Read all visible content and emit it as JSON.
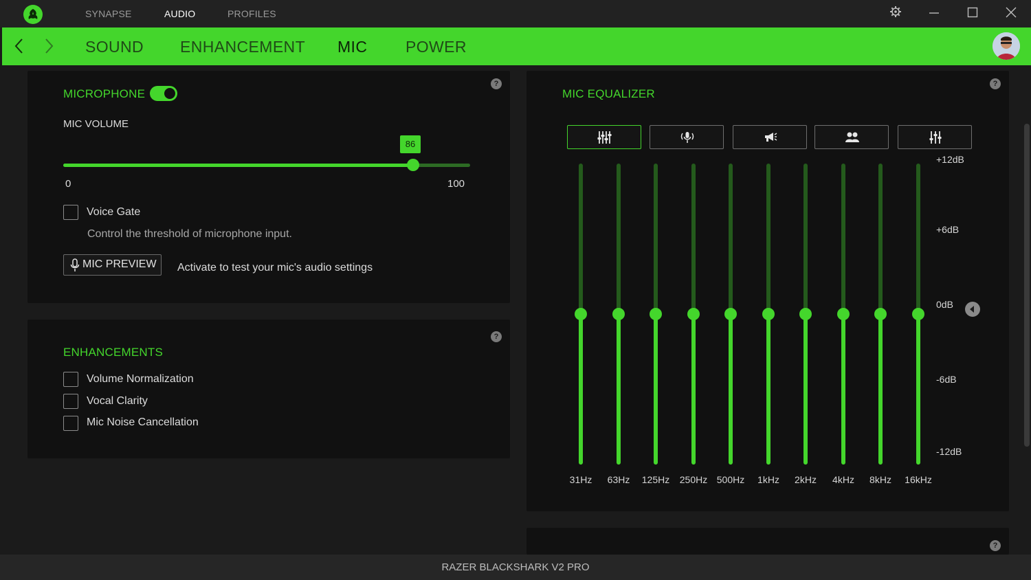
{
  "app": {
    "top_nav": [
      "SYNAPSE",
      "AUDIO",
      "PROFILES"
    ],
    "active_top_nav": "AUDIO"
  },
  "tabs": [
    "SOUND",
    "ENHANCEMENT",
    "MIC",
    "POWER"
  ],
  "active_tab": "MIC",
  "microphone": {
    "title": "MICROPHONE",
    "enabled": true,
    "volume_label": "MIC VOLUME",
    "volume_value": "86",
    "volume_min": "0",
    "volume_max": "100",
    "voice_gate_label": "Voice Gate",
    "voice_gate_desc": "Control the threshold of microphone input.",
    "voice_gate_checked": false,
    "preview_button": "MIC PREVIEW",
    "preview_desc": "Activate to test your mic's audio settings"
  },
  "enhancements": {
    "title": "ENHANCEMENTS",
    "options": [
      {
        "label": "Volume Normalization",
        "checked": false
      },
      {
        "label": "Vocal Clarity",
        "checked": false
      },
      {
        "label": "Mic Noise Cancellation",
        "checked": false
      }
    ]
  },
  "mic_equalizer": {
    "title": "MIC EQUALIZER",
    "presets": [
      "sliders-icon",
      "mic-broadcast-icon",
      "megaphone-icon",
      "people-icon",
      "custom-sliders-icon"
    ],
    "active_preset": 0,
    "db_labels": [
      "+12dB",
      "+6dB",
      "0dB",
      "-6dB",
      "-12dB"
    ],
    "bands": [
      {
        "freq": "31Hz",
        "gain_db": 0
      },
      {
        "freq": "63Hz",
        "gain_db": 0
      },
      {
        "freq": "125Hz",
        "gain_db": 0
      },
      {
        "freq": "250Hz",
        "gain_db": 0
      },
      {
        "freq": "500Hz",
        "gain_db": 0
      },
      {
        "freq": "1kHz",
        "gain_db": 0
      },
      {
        "freq": "2kHz",
        "gain_db": 0
      },
      {
        "freq": "4kHz",
        "gain_db": 0
      },
      {
        "freq": "8kHz",
        "gain_db": 0
      },
      {
        "freq": "16kHz",
        "gain_db": 0
      }
    ]
  },
  "footer": {
    "device_name": "RAZER BLACKSHARK V2 PRO"
  },
  "help_icon_text": "?",
  "colors": {
    "accent": "#44d62c",
    "panel": "#111111",
    "background": "#1b1b1b"
  }
}
